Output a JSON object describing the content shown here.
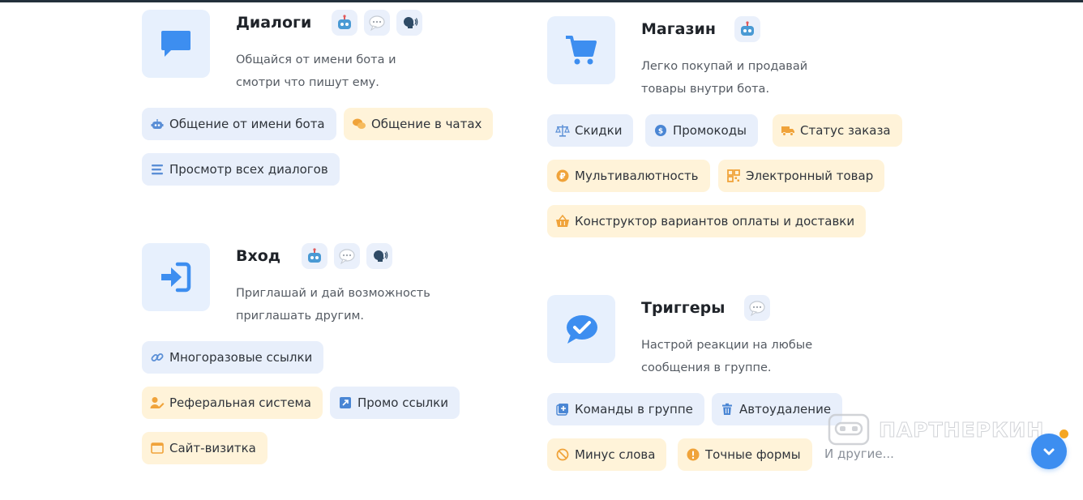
{
  "colors": {
    "accent": "#3d8ef0",
    "tile_bg": "#e7f0fd",
    "chip_blue": "#e8effb",
    "chip_yellow": "#fff3d9",
    "badge_dot": "#f5a623"
  },
  "features": {
    "dialogs": {
      "icon": "speech-bubble-icon",
      "title": "Диалоги",
      "desc": [
        "Общайся от имени бота и",
        "смотри что пишут ему."
      ],
      "badges": [
        "robot-icon",
        "chat-bubble-icon",
        "speaking-head-icon"
      ],
      "chips": [
        {
          "label": "Общение от имени бота",
          "icon": "robot-icon",
          "tone": "blue"
        },
        {
          "label": "Общение в чатах",
          "icon": "chats-icon",
          "tone": "yellow"
        },
        {
          "label": "Просмотр всех диалогов",
          "icon": "list-icon",
          "tone": "blue"
        }
      ]
    },
    "shop": {
      "icon": "cart-icon",
      "title": "Магазин",
      "desc": [
        "Легко покупай и продавай",
        "товары внутри бота."
      ],
      "badges": [
        "robot-icon"
      ],
      "chips": [
        {
          "label": "Скидки",
          "icon": "scales-icon",
          "tone": "blue"
        },
        {
          "label": "Промокоды",
          "icon": "coin-icon",
          "tone": "blue"
        },
        {
          "label": "Статус заказа",
          "icon": "truck-icon",
          "tone": "yellow"
        },
        {
          "label": "Мультивалютность",
          "icon": "ruble-icon",
          "tone": "yellow"
        },
        {
          "label": "Электронный товар",
          "icon": "qr-icon",
          "tone": "yellow"
        },
        {
          "label": "Конструктор вариантов оплаты и доставки",
          "icon": "basket-icon",
          "tone": "yellow"
        }
      ]
    },
    "login": {
      "icon": "sign-in-icon",
      "title": "Вход",
      "desc": [
        "Приглашай и дай возможность",
        "приглашать другим."
      ],
      "badges": [
        "robot-icon",
        "chat-bubble-icon",
        "speaking-head-icon"
      ],
      "chips": [
        {
          "label": "Многоразовые ссылки",
          "icon": "link-icon",
          "tone": "blue"
        },
        {
          "label": "Реферальная система",
          "icon": "user-edit-icon",
          "tone": "yellow"
        },
        {
          "label": "Промо ссылки",
          "icon": "external-link-icon",
          "tone": "blue"
        },
        {
          "label": "Сайт-визитка",
          "icon": "browser-window-icon",
          "tone": "yellow"
        }
      ]
    },
    "triggers": {
      "icon": "check-bubble-icon",
      "title": "Триггеры",
      "desc": [
        "Настрой реакции на любые",
        "сообщения в группе."
      ],
      "badges": [
        "chat-bubble-icon"
      ],
      "chips": [
        {
          "label": "Команды в группе",
          "icon": "plus-box-icon",
          "tone": "blue"
        },
        {
          "label": "Автоудаление",
          "icon": "trash-icon",
          "tone": "blue"
        },
        {
          "label": "Минус слова",
          "icon": "forbidden-icon",
          "tone": "yellow"
        },
        {
          "label": "Точные формы",
          "icon": "alert-icon",
          "tone": "yellow"
        }
      ],
      "more": "И другие..."
    }
  },
  "watermark": "ПАРТНЕРКИН",
  "scroll_button": {
    "icon": "chevron-down-icon"
  }
}
